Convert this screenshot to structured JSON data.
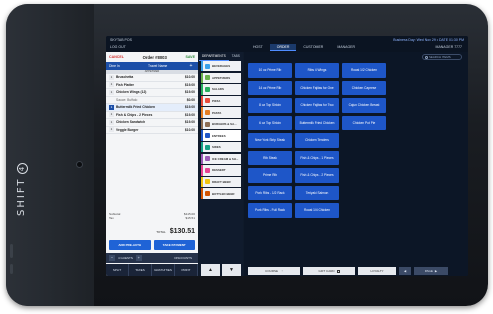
{
  "device": {
    "brand": "SHIFT",
    "brand_badge": "4"
  },
  "topbar": {
    "store": "SKYTAB POS",
    "logout": "LOG OUT",
    "status": "Business Day: Wed Nov 29 • DATE 01:30 PM",
    "user": "MANAGER 7777",
    "tabs": [
      "HOST",
      "ORDER",
      "CUSTOMER",
      "MANAGER"
    ],
    "active_tab": "ORDER"
  },
  "order": {
    "cancel": "CANCEL",
    "title": "Order #8003",
    "save": "SAVE",
    "dine_in": "Dine In",
    "guest": "Travel Name",
    "section": "APPETIZER",
    "lines": [
      {
        "qty": "1",
        "name": "Bruschetta",
        "price": "$10.00",
        "sel": false
      },
      {
        "qty": "1",
        "name": "Fish Platter",
        "price": "$19.00",
        "sel": false
      },
      {
        "qty": "1",
        "name": "Chicken Wings (12)",
        "price": "$19.00",
        "sel": false
      },
      {
        "qty": "",
        "name": "Sauce: Buffalo",
        "price": "$0.00",
        "sel": false
      },
      {
        "qty": "1",
        "name": "Buttermilk Fried Chicken",
        "price": "$19.00",
        "sel": true
      },
      {
        "qty": "1",
        "name": "Fish & Chips - 2 Pieces",
        "price": "$19.00",
        "sel": false
      },
      {
        "qty": "1",
        "name": "Chicken Sandwich",
        "price": "$19.00",
        "sel": false
      },
      {
        "qty": "1",
        "name": "Veggie Burger",
        "price": "$10.00",
        "sel": false
      }
    ],
    "subtotal_label": "Subtotal",
    "subtotal": "$115.00",
    "tax_label": "Tax",
    "tax": "$15.51",
    "total_label": "TOTAL",
    "total": "$130.51",
    "pay_buttons": [
      "ADD PRE-AUTH",
      "TAKE PAYMENT"
    ],
    "guests_label": "4 GUESTS",
    "discounts_label": "DISCOUNTS",
    "actions": [
      "SPLIT",
      "TAXES",
      "GRATUITIES",
      "PRINT"
    ]
  },
  "departments": {
    "tabs": [
      "DEPARTMENTS",
      "TABS"
    ],
    "items": [
      {
        "label": "BEVERAGES",
        "color": "#3aa0e8"
      },
      {
        "label": "APPETIZERS",
        "color": "#6ab04c"
      },
      {
        "label": "SALADS",
        "color": "#27ae60"
      },
      {
        "label": "PIZZA",
        "color": "#e74c3c"
      },
      {
        "label": "PASTA",
        "color": "#e67e22"
      },
      {
        "label": "BURGERS & SA...",
        "color": "#8e6e53"
      },
      {
        "label": "ENTREES",
        "color": "#1e56c8"
      },
      {
        "label": "SIDES",
        "color": "#16a085"
      },
      {
        "label": "ICE CREAM & SH...",
        "color": "#9b59b6"
      },
      {
        "label": "DESSERT",
        "color": "#e84393"
      },
      {
        "label": "DRAFT BEER",
        "color": "#f1c40f"
      },
      {
        "label": "BOTTLED BEER",
        "color": "#d35400"
      }
    ],
    "active": "ENTREES"
  },
  "items": {
    "search_placeholder": "SEARCH ITEMS",
    "grid": [
      "10 oz Prime Rib",
      "Ribs 4 Wings",
      "Roast 1/2 Chicken",
      "",
      "14 oz Prime Rib",
      "Chicken Fajitas for One",
      "Chicken Caprese",
      "",
      "8 oz Top Sirloin",
      "Chicken Fajitas for Two",
      "Cajun Chicken Breast",
      "",
      "6 oz Top Sirloin",
      "Buttermilk Fried Chicken",
      "Chicken Pot Pie",
      "",
      "New York Strip Steak",
      "Chicken Tenders",
      "",
      "",
      "Rib Steak",
      "Fish & Chips - 1 Pieces",
      "",
      "",
      "Prime Rib",
      "Fish & Chips - 2 Pieces",
      "",
      "",
      "Pork Ribs - 1/2 Rack",
      "Teriyaki Salmon",
      "",
      "",
      "Pork Ribs - Full Rack",
      "Roast 1/4 Chicken",
      "",
      ""
    ],
    "bottom": {
      "course": "COURSE",
      "gift_card": "GIFT CARD",
      "loyalty": "LOYALTY",
      "page": "PAGE"
    }
  }
}
